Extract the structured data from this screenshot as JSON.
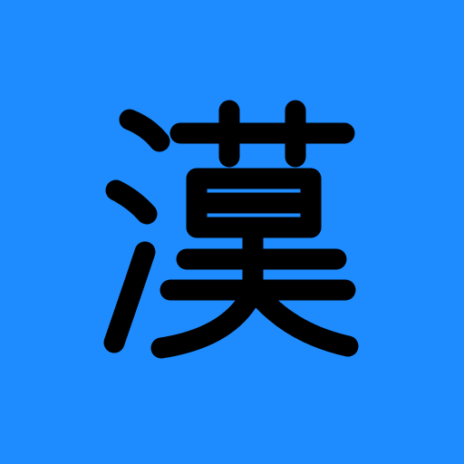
{
  "icon": {
    "character": "漢",
    "background_color": "#1e8cff",
    "glyph_color": "#000000"
  }
}
